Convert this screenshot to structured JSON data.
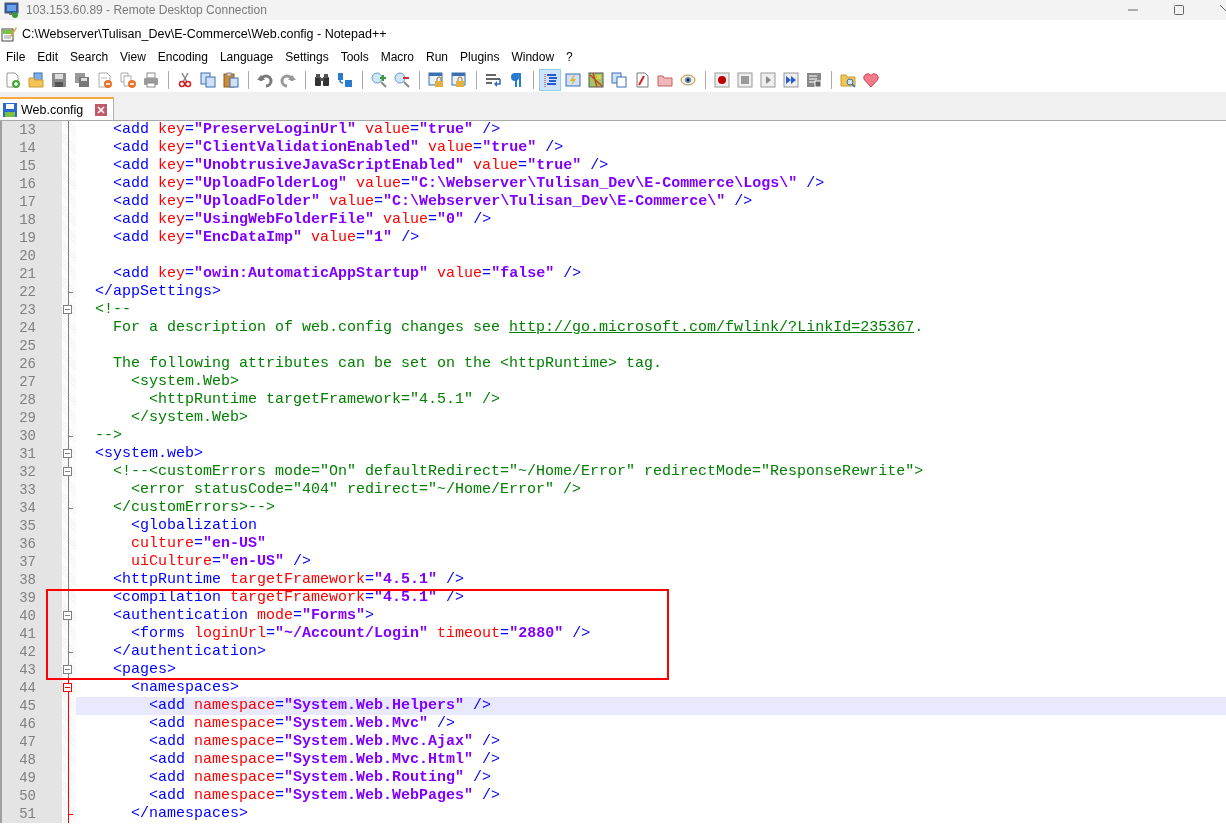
{
  "remote_window": {
    "title": "103.153.60.89 - Remote Desktop Connection"
  },
  "window": {
    "title": "C:\\Webserver\\Tulisan_Dev\\E-Commerce\\Web.config - Notepad++"
  },
  "menu": [
    "File",
    "Edit",
    "Search",
    "View",
    "Encoding",
    "Language",
    "Settings",
    "Tools",
    "Macro",
    "Run",
    "Plugins",
    "Window",
    "?"
  ],
  "toolbar": [
    [
      {
        "pressed": false
      },
      {
        "pressed": false
      },
      {
        "pressed": false
      },
      {
        "pressed": false
      },
      {
        "pressed": false
      },
      {
        "pressed": false
      },
      {
        "pressed": false
      }
    ],
    [
      {
        "pressed": false
      },
      {
        "pressed": false
      },
      {
        "pressed": false
      }
    ],
    [
      {
        "pressed": false
      },
      {
        "pressed": false
      }
    ],
    [
      {
        "pressed": false
      },
      {
        "pressed": false
      }
    ],
    [
      {
        "pressed": false
      },
      {
        "pressed": false
      }
    ],
    [
      {
        "pressed": false
      },
      {
        "pressed": false
      }
    ],
    [
      {
        "pressed": false
      },
      {
        "pressed": false
      }
    ],
    [
      {
        "pressed": true
      },
      {
        "pressed": false
      },
      {
        "pressed": false
      },
      {
        "pressed": false
      },
      {
        "pressed": false
      },
      {
        "pressed": false
      },
      {
        "pressed": false
      }
    ],
    [
      {
        "pressed": false
      },
      {
        "pressed": false
      },
      {
        "pressed": false
      },
      {
        "pressed": false
      },
      {
        "pressed": false
      }
    ],
    [
      {
        "pressed": false
      },
      {
        "pressed": false
      }
    ]
  ],
  "tabs": [
    {
      "label": "Web.config",
      "selected": true
    }
  ],
  "editor": {
    "lines": [
      {
        "number": "13",
        "kind": "plain",
        "current": false,
        "boxed": false,
        "current_fold": false,
        "tokens": [
          {
            "kind": "tag",
            "text": "    <add "
          },
          {
            "kind": "attr",
            "text": "key"
          },
          {
            "kind": "tag",
            "text": "="
          },
          {
            "kind": "value",
            "text": "\"PreserveLoginUrl\""
          },
          {
            "kind": "attr",
            "text": " value"
          },
          {
            "kind": "tag",
            "text": "="
          },
          {
            "kind": "value",
            "text": "\"true\""
          },
          {
            "kind": "tag",
            "text": " />"
          }
        ]
      },
      {
        "number": "14",
        "kind": "plain",
        "current": false,
        "boxed": false,
        "current_fold": false,
        "tokens": [
          {
            "kind": "tag",
            "text": "    <add "
          },
          {
            "kind": "attr",
            "text": "key"
          },
          {
            "kind": "tag",
            "text": "="
          },
          {
            "kind": "value",
            "text": "\"ClientValidationEnabled\""
          },
          {
            "kind": "attr",
            "text": " value"
          },
          {
            "kind": "tag",
            "text": "="
          },
          {
            "kind": "value",
            "text": "\"true\""
          },
          {
            "kind": "tag",
            "text": " />"
          }
        ]
      },
      {
        "number": "15",
        "kind": "plain",
        "current": false,
        "boxed": false,
        "current_fold": false,
        "tokens": [
          {
            "kind": "tag",
            "text": "    <add "
          },
          {
            "kind": "attr",
            "text": "key"
          },
          {
            "kind": "tag",
            "text": "="
          },
          {
            "kind": "value",
            "text": "\"UnobtrusiveJavaScriptEnabled\""
          },
          {
            "kind": "attr",
            "text": " value"
          },
          {
            "kind": "tag",
            "text": "="
          },
          {
            "kind": "value",
            "text": "\"true\""
          },
          {
            "kind": "tag",
            "text": " />"
          }
        ]
      },
      {
        "number": "16",
        "kind": "plain",
        "current": false,
        "boxed": false,
        "current_fold": false,
        "tokens": [
          {
            "kind": "tag",
            "text": "    <add "
          },
          {
            "kind": "attr",
            "text": "key"
          },
          {
            "kind": "tag",
            "text": "="
          },
          {
            "kind": "value",
            "text": "\"UploadFolderLog\""
          },
          {
            "kind": "attr",
            "text": " value"
          },
          {
            "kind": "tag",
            "text": "="
          },
          {
            "kind": "value",
            "text": "\"C:\\Webserver\\Tulisan_Dev\\E-Commerce\\Logs\\\""
          },
          {
            "kind": "tag",
            "text": " />"
          }
        ]
      },
      {
        "number": "17",
        "kind": "plain",
        "current": false,
        "boxed": false,
        "current_fold": false,
        "tokens": [
          {
            "kind": "tag",
            "text": "    <add "
          },
          {
            "kind": "attr",
            "text": "key"
          },
          {
            "kind": "tag",
            "text": "="
          },
          {
            "kind": "value",
            "text": "\"UploadFolder\""
          },
          {
            "kind": "attr",
            "text": " value"
          },
          {
            "kind": "tag",
            "text": "="
          },
          {
            "kind": "value",
            "text": "\"C:\\Webserver\\Tulisan_Dev\\E-Commerce\\\""
          },
          {
            "kind": "tag",
            "text": " />"
          }
        ]
      },
      {
        "number": "18",
        "kind": "plain",
        "current": false,
        "boxed": false,
        "current_fold": false,
        "tokens": [
          {
            "kind": "tag",
            "text": "    <add "
          },
          {
            "kind": "attr",
            "text": "key"
          },
          {
            "kind": "tag",
            "text": "="
          },
          {
            "kind": "value",
            "text": "\"UsingWebFolderFile\""
          },
          {
            "kind": "attr",
            "text": " value"
          },
          {
            "kind": "tag",
            "text": "="
          },
          {
            "kind": "value",
            "text": "\"0\""
          },
          {
            "kind": "tag",
            "text": " />"
          }
        ]
      },
      {
        "number": "19",
        "kind": "plain",
        "current": false,
        "boxed": false,
        "current_fold": false,
        "tokens": [
          {
            "kind": "tag",
            "text": "    <add "
          },
          {
            "kind": "attr",
            "text": "key"
          },
          {
            "kind": "tag",
            "text": "="
          },
          {
            "kind": "value",
            "text": "\"EncDataImp\""
          },
          {
            "kind": "attr",
            "text": " value"
          },
          {
            "kind": "tag",
            "text": "="
          },
          {
            "kind": "value",
            "text": "\"1\""
          },
          {
            "kind": "tag",
            "text": " />"
          }
        ]
      },
      {
        "number": "20",
        "kind": "plain",
        "current": false,
        "boxed": false,
        "current_fold": false
      },
      {
        "number": "21",
        "kind": "plain",
        "current": false,
        "boxed": false,
        "current_fold": false,
        "tokens": [
          {
            "kind": "tag",
            "text": "    <add "
          },
          {
            "kind": "attr",
            "text": "key"
          },
          {
            "kind": "tag",
            "text": "="
          },
          {
            "kind": "value",
            "text": "\"owin:AutomaticAppStartup\""
          },
          {
            "kind": "attr",
            "text": " value"
          },
          {
            "kind": "tag",
            "text": "="
          },
          {
            "kind": "value",
            "text": "\"false\""
          },
          {
            "kind": "tag",
            "text": " />"
          }
        ]
      },
      {
        "number": "22",
        "kind": "closer",
        "current": false,
        "boxed": false,
        "current_fold": false,
        "tokens": [
          {
            "kind": "tag",
            "text": "  </appSettings>"
          }
        ]
      },
      {
        "number": "23",
        "kind": "opener",
        "current": false,
        "boxed": false,
        "current_fold": false,
        "tokens": [
          {
            "kind": "comment",
            "text": "  <!--"
          }
        ]
      },
      {
        "number": "24",
        "kind": "plain",
        "current": false,
        "boxed": false,
        "current_fold": false,
        "tokens": [
          {
            "kind": "comment",
            "text": "    For a description of web.config changes see "
          },
          {
            "kind": "link",
            "text": "http://go.microsoft.com/fwlink/?LinkId=235367"
          },
          {
            "kind": "comment",
            "text": "."
          }
        ]
      },
      {
        "number": "25",
        "kind": "plain",
        "current": false,
        "boxed": false,
        "current_fold": false
      },
      {
        "number": "26",
        "kind": "plain",
        "current": false,
        "boxed": false,
        "current_fold": false,
        "tokens": [
          {
            "kind": "comment",
            "text": "    The following attributes can be set on the <httpRuntime> tag."
          }
        ]
      },
      {
        "number": "27",
        "kind": "plain",
        "current": false,
        "boxed": false,
        "current_fold": false,
        "tokens": [
          {
            "kind": "comment",
            "text": "      <system.Web>"
          }
        ]
      },
      {
        "number": "28",
        "kind": "plain",
        "current": false,
        "boxed": false,
        "current_fold": false,
        "tokens": [
          {
            "kind": "comment",
            "text": "        <httpRuntime targetFramework=\"4.5.1\" />"
          }
        ]
      },
      {
        "number": "29",
        "kind": "plain",
        "current": false,
        "boxed": false,
        "current_fold": false,
        "tokens": [
          {
            "kind": "comment",
            "text": "      </system.Web>"
          }
        ]
      },
      {
        "number": "30",
        "kind": "closer",
        "current": false,
        "boxed": false,
        "current_fold": false,
        "tokens": [
          {
            "kind": "comment",
            "text": "  -->"
          }
        ]
      },
      {
        "number": "31",
        "kind": "opener",
        "current": false,
        "boxed": false,
        "current_fold": false,
        "tokens": [
          {
            "kind": "tag",
            "text": "  <system.web>"
          }
        ]
      },
      {
        "number": "32",
        "kind": "opener",
        "current": false,
        "boxed": false,
        "current_fold": false,
        "tokens": [
          {
            "kind": "comment",
            "text": "    <!--<customErrors mode=\"On\" defaultRedirect=\"~/Home/Error\" redirectMode=\"ResponseRewrite\">"
          }
        ]
      },
      {
        "number": "33",
        "kind": "plain",
        "current": false,
        "boxed": false,
        "current_fold": false,
        "tokens": [
          {
            "kind": "comment",
            "text": "      <error statusCode=\"404\" redirect=\"~/Home/Error\" />"
          }
        ]
      },
      {
        "number": "34",
        "kind": "closer",
        "current": false,
        "boxed": false,
        "current_fold": false,
        "tokens": [
          {
            "kind": "comment",
            "text": "    </customErrors>-->"
          }
        ]
      },
      {
        "number": "35",
        "kind": "plain",
        "current": false,
        "boxed": false,
        "current_fold": false,
        "tokens": [
          {
            "kind": "tag",
            "text": "      <globalization"
          }
        ]
      },
      {
        "number": "36",
        "kind": "plain",
        "current": false,
        "boxed": false,
        "current_fold": false,
        "tokens": [
          {
            "kind": "attr",
            "text": "      culture"
          },
          {
            "kind": "tag",
            "text": "="
          },
          {
            "kind": "value",
            "text": "\"en-US\""
          }
        ]
      },
      {
        "number": "37",
        "kind": "plain",
        "current": false,
        "boxed": false,
        "current_fold": false,
        "tokens": [
          {
            "kind": "attr",
            "text": "      uiCulture"
          },
          {
            "kind": "tag",
            "text": "="
          },
          {
            "kind": "value",
            "text": "\"en-US\""
          },
          {
            "kind": "tag",
            "text": " />"
          }
        ]
      },
      {
        "number": "38",
        "kind": "plain",
        "current": false,
        "boxed": false,
        "current_fold": false,
        "tokens": [
          {
            "kind": "tag",
            "text": "    <httpRuntime "
          },
          {
            "kind": "attr",
            "text": "targetFramework"
          },
          {
            "kind": "tag",
            "text": "="
          },
          {
            "kind": "value",
            "text": "\"4.5.1\""
          },
          {
            "kind": "tag",
            "text": " />"
          }
        ]
      },
      {
        "number": "39",
        "kind": "plain",
        "current": false,
        "boxed": true,
        "current_fold": false,
        "tokens": [
          {
            "kind": "tag",
            "text": "    <compilation "
          },
          {
            "kind": "attr",
            "text": "targetFramework"
          },
          {
            "kind": "tag",
            "text": "="
          },
          {
            "kind": "value",
            "text": "\"4.5.1\""
          },
          {
            "kind": "tag",
            "text": " />"
          }
        ]
      },
      {
        "number": "40",
        "kind": "opener",
        "current": false,
        "boxed": true,
        "current_fold": false,
        "tokens": [
          {
            "kind": "tag",
            "text": "    <authentication "
          },
          {
            "kind": "attr",
            "text": "mode"
          },
          {
            "kind": "tag",
            "text": "="
          },
          {
            "kind": "value",
            "text": "\"Forms\""
          },
          {
            "kind": "tag",
            "text": ">"
          }
        ]
      },
      {
        "number": "41",
        "kind": "plain",
        "current": false,
        "boxed": true,
        "current_fold": false,
        "tokens": [
          {
            "kind": "tag",
            "text": "      <forms "
          },
          {
            "kind": "attr",
            "text": "loginUrl"
          },
          {
            "kind": "tag",
            "text": "="
          },
          {
            "kind": "value",
            "text": "\"~/Account/Login\""
          },
          {
            "kind": "attr",
            "text": " timeout"
          },
          {
            "kind": "tag",
            "text": "="
          },
          {
            "kind": "value",
            "text": "\"2880\""
          },
          {
            "kind": "tag",
            "text": " />"
          }
        ]
      },
      {
        "number": "42",
        "kind": "closer",
        "current": false,
        "boxed": true,
        "current_fold": false,
        "tokens": [
          {
            "kind": "tag",
            "text": "    </authentication>"
          }
        ]
      },
      {
        "number": "43",
        "kind": "opener",
        "current": false,
        "boxed": true,
        "current_fold": false,
        "tokens": [
          {
            "kind": "tag",
            "text": "    <pages>"
          }
        ]
      },
      {
        "number": "44",
        "kind": "opener",
        "current": false,
        "boxed": false,
        "current_fold": true,
        "tokens": [
          {
            "kind": "tag",
            "text": "      <namespaces>"
          }
        ]
      },
      {
        "number": "45",
        "kind": "plain",
        "current": true,
        "boxed": false,
        "current_fold": true,
        "tokens": [
          {
            "kind": "tag",
            "text": "        <add "
          },
          {
            "kind": "attr",
            "text": "namespace"
          },
          {
            "kind": "tag",
            "text": "="
          },
          {
            "kind": "value",
            "text": "\"System.Web.Helpers\""
          },
          {
            "kind": "tag",
            "text": " />"
          }
        ]
      },
      {
        "number": "46",
        "kind": "plain",
        "current": false,
        "boxed": false,
        "current_fold": true,
        "tokens": [
          {
            "kind": "tag",
            "text": "        <add "
          },
          {
            "kind": "attr",
            "text": "namespace"
          },
          {
            "kind": "tag",
            "text": "="
          },
          {
            "kind": "value",
            "text": "\"System.Web.Mvc\""
          },
          {
            "kind": "tag",
            "text": " />"
          }
        ]
      },
      {
        "number": "47",
        "kind": "plain",
        "current": false,
        "boxed": false,
        "current_fold": true,
        "tokens": [
          {
            "kind": "tag",
            "text": "        <add "
          },
          {
            "kind": "attr",
            "text": "namespace"
          },
          {
            "kind": "tag",
            "text": "="
          },
          {
            "kind": "value",
            "text": "\"System.Web.Mvc.Ajax\""
          },
          {
            "kind": "tag",
            "text": " />"
          }
        ]
      },
      {
        "number": "48",
        "kind": "plain",
        "current": false,
        "boxed": false,
        "current_fold": true,
        "tokens": [
          {
            "kind": "tag",
            "text": "        <add "
          },
          {
            "kind": "attr",
            "text": "namespace"
          },
          {
            "kind": "tag",
            "text": "="
          },
          {
            "kind": "value",
            "text": "\"System.Web.Mvc.Html\""
          },
          {
            "kind": "tag",
            "text": " />"
          }
        ]
      },
      {
        "number": "49",
        "kind": "plain",
        "current": false,
        "boxed": false,
        "current_fold": true,
        "tokens": [
          {
            "kind": "tag",
            "text": "        <add "
          },
          {
            "kind": "attr",
            "text": "namespace"
          },
          {
            "kind": "tag",
            "text": "="
          },
          {
            "kind": "value",
            "text": "\"System.Web.Routing\""
          },
          {
            "kind": "tag",
            "text": " />"
          }
        ]
      },
      {
        "number": "50",
        "kind": "plain",
        "current": false,
        "boxed": false,
        "current_fold": true,
        "tokens": [
          {
            "kind": "tag",
            "text": "        <add "
          },
          {
            "kind": "attr",
            "text": "namespace"
          },
          {
            "kind": "tag",
            "text": "="
          },
          {
            "kind": "value",
            "text": "\"System.Web.WebPages\""
          },
          {
            "kind": "tag",
            "text": " />"
          }
        ]
      },
      {
        "number": "51",
        "kind": "closer",
        "current": false,
        "boxed": false,
        "current_fold": true,
        "tokens": [
          {
            "kind": "tag",
            "text": "      </namespaces>"
          }
        ]
      }
    ]
  }
}
